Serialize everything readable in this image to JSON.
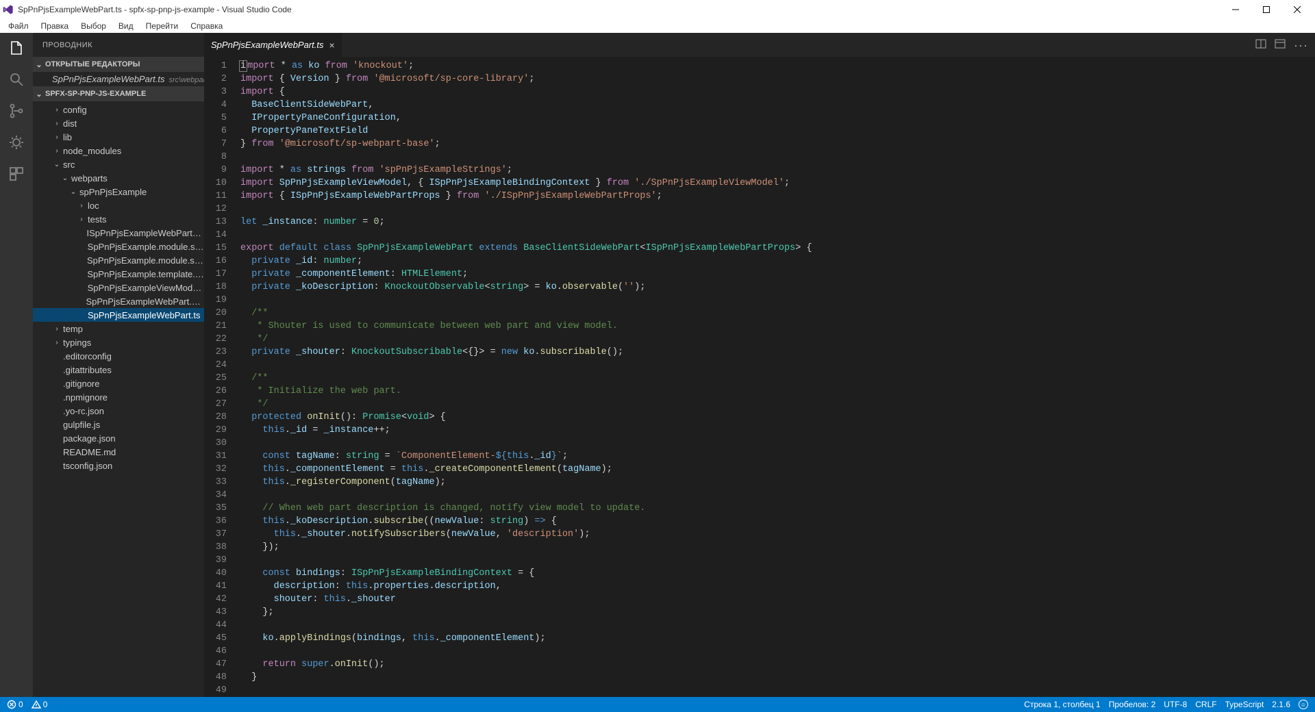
{
  "window_title": "SpPnPjsExampleWebPart.ts - spfx-sp-pnp-js-example - Visual Studio Code",
  "menus": [
    "Файл",
    "Правка",
    "Выбор",
    "Вид",
    "Перейти",
    "Справка"
  ],
  "sidebar_title": "ПРОВОДНИК",
  "open_editors_hdr": "ОТКРЫТЫЕ РЕДАКТОРЫ",
  "open_editor_name": "SpPnPjsExampleWebPart.ts",
  "open_editor_path": "src\\webparts\\spPnPjsEx…",
  "workspace_name": "SPFX-SP-PNP-JS-EXAMPLE",
  "tree": [
    {
      "d": 1,
      "chev": "›",
      "name": "config"
    },
    {
      "d": 1,
      "chev": "›",
      "name": "dist"
    },
    {
      "d": 1,
      "chev": "›",
      "name": "lib"
    },
    {
      "d": 1,
      "chev": "›",
      "name": "node_modules"
    },
    {
      "d": 1,
      "chev": "⌄",
      "name": "src"
    },
    {
      "d": 2,
      "chev": "⌄",
      "name": "webparts"
    },
    {
      "d": 3,
      "chev": "⌄",
      "name": "spPnPjsExample"
    },
    {
      "d": 4,
      "chev": "›",
      "name": "loc"
    },
    {
      "d": 4,
      "chev": "›",
      "name": "tests"
    },
    {
      "d": 4,
      "chev": "",
      "name": "ISpPnPjsExampleWebPartProps.ts"
    },
    {
      "d": 4,
      "chev": "",
      "name": "SpPnPjsExample.module.scss"
    },
    {
      "d": 4,
      "chev": "",
      "name": "SpPnPjsExample.module.scss.ts"
    },
    {
      "d": 4,
      "chev": "",
      "name": "SpPnPjsExample.template.html"
    },
    {
      "d": 4,
      "chev": "",
      "name": "SpPnPjsExampleViewModel.ts"
    },
    {
      "d": 4,
      "chev": "",
      "name": "SpPnPjsExampleWebPart.manifest.json"
    },
    {
      "d": 4,
      "chev": "",
      "name": "SpPnPjsExampleWebPart.ts",
      "sel": true
    },
    {
      "d": 1,
      "chev": "›",
      "name": "temp"
    },
    {
      "d": 1,
      "chev": "›",
      "name": "typings"
    },
    {
      "d": 1,
      "chev": "",
      "name": ".editorconfig"
    },
    {
      "d": 1,
      "chev": "",
      "name": ".gitattributes"
    },
    {
      "d": 1,
      "chev": "",
      "name": ".gitignore"
    },
    {
      "d": 1,
      "chev": "",
      "name": ".npmignore"
    },
    {
      "d": 1,
      "chev": "",
      "name": ".yo-rc.json"
    },
    {
      "d": 1,
      "chev": "",
      "name": "gulpfile.js"
    },
    {
      "d": 1,
      "chev": "",
      "name": "package.json"
    },
    {
      "d": 1,
      "chev": "",
      "name": "README.md"
    },
    {
      "d": 1,
      "chev": "",
      "name": "tsconfig.json"
    }
  ],
  "tab_label": "SpPnPjsExampleWebPart.ts",
  "status": {
    "errors": "0",
    "warnings": "0",
    "cursor": "Строка 1, столбец 1",
    "spaces": "Пробелов: 2",
    "encoding": "UTF-8",
    "eol": "CRLF",
    "lang": "TypeScript",
    "ver": "2.1.6"
  },
  "code": [
    [
      [
        "i",
        "import"
      ],
      [
        "",
        " * "
      ],
      [
        "kw",
        "as"
      ],
      [
        "",
        " "
      ],
      [
        "v",
        "ko"
      ],
      [
        "",
        " "
      ],
      [
        "i",
        "from"
      ],
      [
        "",
        " "
      ],
      [
        "s",
        "'knockout'"
      ],
      [
        "",
        ";"
      ]
    ],
    [
      [
        "i",
        "import"
      ],
      [
        "",
        " { "
      ],
      [
        "v",
        "Version"
      ],
      [
        "",
        " } "
      ],
      [
        "i",
        "from"
      ],
      [
        "",
        " "
      ],
      [
        "s",
        "'@microsoft/sp-core-library'"
      ],
      [
        "",
        ";"
      ]
    ],
    [
      [
        "i",
        "import"
      ],
      [
        "",
        " {"
      ]
    ],
    [
      [
        "",
        "  "
      ],
      [
        "v",
        "BaseClientSideWebPart"
      ],
      [
        "",
        ","
      ]
    ],
    [
      [
        "",
        "  "
      ],
      [
        "v",
        "IPropertyPaneConfiguration"
      ],
      [
        "",
        ","
      ]
    ],
    [
      [
        "",
        "  "
      ],
      [
        "v",
        "PropertyPaneTextField"
      ]
    ],
    [
      [
        "",
        "} "
      ],
      [
        "i",
        "from"
      ],
      [
        "",
        " "
      ],
      [
        "s",
        "'@microsoft/sp-webpart-base'"
      ],
      [
        "",
        ";"
      ]
    ],
    [],
    [
      [
        "i",
        "import"
      ],
      [
        "",
        " * "
      ],
      [
        "kw",
        "as"
      ],
      [
        "",
        " "
      ],
      [
        "v",
        "strings"
      ],
      [
        "",
        " "
      ],
      [
        "i",
        "from"
      ],
      [
        "",
        " "
      ],
      [
        "s",
        "'spPnPjsExampleStrings'"
      ],
      [
        "",
        ";"
      ]
    ],
    [
      [
        "i",
        "import"
      ],
      [
        "",
        " "
      ],
      [
        "v",
        "SpPnPjsExampleViewModel"
      ],
      [
        "",
        ", { "
      ],
      [
        "v",
        "ISpPnPjsExampleBindingContext"
      ],
      [
        "",
        " } "
      ],
      [
        "i",
        "from"
      ],
      [
        "",
        " "
      ],
      [
        "s",
        "'./SpPnPjsExampleViewModel'"
      ],
      [
        "",
        ";"
      ]
    ],
    [
      [
        "i",
        "import"
      ],
      [
        "",
        " { "
      ],
      [
        "v",
        "ISpPnPjsExampleWebPartProps"
      ],
      [
        "",
        " } "
      ],
      [
        "i",
        "from"
      ],
      [
        "",
        " "
      ],
      [
        "s",
        "'./ISpPnPjsExampleWebPartProps'"
      ],
      [
        "",
        ";"
      ]
    ],
    [],
    [
      [
        "kw",
        "let"
      ],
      [
        "",
        " "
      ],
      [
        "v",
        "_instance"
      ],
      [
        "",
        ": "
      ],
      [
        "t",
        "number"
      ],
      [
        "",
        " = "
      ],
      [
        "n",
        "0"
      ],
      [
        "",
        ";"
      ]
    ],
    [],
    [
      [
        "i",
        "export"
      ],
      [
        "",
        " "
      ],
      [
        "kw",
        "default"
      ],
      [
        "",
        " "
      ],
      [
        "kw",
        "class"
      ],
      [
        "",
        " "
      ],
      [
        "t",
        "SpPnPjsExampleWebPart"
      ],
      [
        "",
        " "
      ],
      [
        "kw",
        "extends"
      ],
      [
        "",
        " "
      ],
      [
        "t",
        "BaseClientSideWebPart"
      ],
      [
        "",
        "<"
      ],
      [
        "t",
        "ISpPnPjsExampleWebPartProps"
      ],
      [
        "",
        "> {"
      ]
    ],
    [
      [
        "",
        "  "
      ],
      [
        "kw",
        "private"
      ],
      [
        "",
        " "
      ],
      [
        "v",
        "_id"
      ],
      [
        "",
        ": "
      ],
      [
        "t",
        "number"
      ],
      [
        "",
        ";"
      ]
    ],
    [
      [
        "",
        "  "
      ],
      [
        "kw",
        "private"
      ],
      [
        "",
        " "
      ],
      [
        "v",
        "_componentElement"
      ],
      [
        "",
        ": "
      ],
      [
        "t",
        "HTMLElement"
      ],
      [
        "",
        ";"
      ]
    ],
    [
      [
        "",
        "  "
      ],
      [
        "kw",
        "private"
      ],
      [
        "",
        " "
      ],
      [
        "v",
        "_koDescription"
      ],
      [
        "",
        ": "
      ],
      [
        "t",
        "KnockoutObservable"
      ],
      [
        "",
        "<"
      ],
      [
        "t",
        "string"
      ],
      [
        "",
        "> = "
      ],
      [
        "v",
        "ko"
      ],
      [
        "",
        "."
      ],
      [
        "f",
        "observable"
      ],
      [
        "",
        "("
      ],
      [
        "s",
        "''"
      ],
      [
        "",
        ");"
      ]
    ],
    [],
    [
      [
        "",
        "  "
      ],
      [
        "c",
        "/**"
      ]
    ],
    [
      [
        "",
        "   "
      ],
      [
        "c",
        "* Shouter is used to communicate between web part and view model."
      ]
    ],
    [
      [
        "",
        "   "
      ],
      [
        "c",
        "*/"
      ]
    ],
    [
      [
        "",
        "  "
      ],
      [
        "kw",
        "private"
      ],
      [
        "",
        " "
      ],
      [
        "v",
        "_shouter"
      ],
      [
        "",
        ": "
      ],
      [
        "t",
        "KnockoutSubscribable"
      ],
      [
        "",
        "<{}> = "
      ],
      [
        "kw",
        "new"
      ],
      [
        "",
        " "
      ],
      [
        "v",
        "ko"
      ],
      [
        "",
        "."
      ],
      [
        "f",
        "subscribable"
      ],
      [
        "",
        "();"
      ]
    ],
    [],
    [
      [
        "",
        "  "
      ],
      [
        "c",
        "/**"
      ]
    ],
    [
      [
        "",
        "   "
      ],
      [
        "c",
        "* Initialize the web part."
      ]
    ],
    [
      [
        "",
        "   "
      ],
      [
        "c",
        "*/"
      ]
    ],
    [
      [
        "",
        "  "
      ],
      [
        "kw",
        "protected"
      ],
      [
        "",
        " "
      ],
      [
        "f",
        "onInit"
      ],
      [
        "",
        "(): "
      ],
      [
        "t",
        "Promise"
      ],
      [
        "",
        "<"
      ],
      [
        "t",
        "void"
      ],
      [
        "",
        "> {"
      ]
    ],
    [
      [
        "",
        "    "
      ],
      [
        "kw",
        "this"
      ],
      [
        "",
        "."
      ],
      [
        "v",
        "_id"
      ],
      [
        "",
        " = "
      ],
      [
        "v",
        "_instance"
      ],
      [
        "",
        "++;"
      ]
    ],
    [],
    [
      [
        "",
        "    "
      ],
      [
        "kw",
        "const"
      ],
      [
        "",
        " "
      ],
      [
        "v",
        "tagName"
      ],
      [
        "",
        ": "
      ],
      [
        "t",
        "string"
      ],
      [
        "",
        " = "
      ],
      [
        "s",
        "`ComponentElement-"
      ],
      [
        "kw",
        "${"
      ],
      [
        "kw",
        "this"
      ],
      [
        "",
        "."
      ],
      [
        "v",
        "_id"
      ],
      [
        "kw",
        "}"
      ],
      [
        "s",
        "`"
      ],
      [
        "",
        ";"
      ]
    ],
    [
      [
        "",
        "    "
      ],
      [
        "kw",
        "this"
      ],
      [
        "",
        "."
      ],
      [
        "v",
        "_componentElement"
      ],
      [
        "",
        " = "
      ],
      [
        "kw",
        "this"
      ],
      [
        "",
        "."
      ],
      [
        "f",
        "_createComponentElement"
      ],
      [
        "",
        "("
      ],
      [
        "v",
        "tagName"
      ],
      [
        "",
        ");"
      ]
    ],
    [
      [
        "",
        "    "
      ],
      [
        "kw",
        "this"
      ],
      [
        "",
        "."
      ],
      [
        "f",
        "_registerComponent"
      ],
      [
        "",
        "("
      ],
      [
        "v",
        "tagName"
      ],
      [
        "",
        ");"
      ]
    ],
    [],
    [
      [
        "",
        "    "
      ],
      [
        "c",
        "// When web part description is changed, notify view model to update."
      ]
    ],
    [
      [
        "",
        "    "
      ],
      [
        "kw",
        "this"
      ],
      [
        "",
        "."
      ],
      [
        "v",
        "_koDescription"
      ],
      [
        "",
        "."
      ],
      [
        "f",
        "subscribe"
      ],
      [
        "",
        "(("
      ],
      [
        "v",
        "newValue"
      ],
      [
        "",
        ": "
      ],
      [
        "t",
        "string"
      ],
      [
        "",
        ") "
      ],
      [
        "kw",
        "=>"
      ],
      [
        "",
        " {"
      ]
    ],
    [
      [
        "",
        "      "
      ],
      [
        "kw",
        "this"
      ],
      [
        "",
        "."
      ],
      [
        "v",
        "_shouter"
      ],
      [
        "",
        "."
      ],
      [
        "f",
        "notifySubscribers"
      ],
      [
        "",
        "("
      ],
      [
        "v",
        "newValue"
      ],
      [
        "",
        ", "
      ],
      [
        "s",
        "'description'"
      ],
      [
        "",
        ");"
      ]
    ],
    [
      [
        "",
        "    });"
      ]
    ],
    [],
    [
      [
        "",
        "    "
      ],
      [
        "kw",
        "const"
      ],
      [
        "",
        " "
      ],
      [
        "v",
        "bindings"
      ],
      [
        "",
        ": "
      ],
      [
        "t",
        "ISpPnPjsExampleBindingContext"
      ],
      [
        "",
        " = {"
      ]
    ],
    [
      [
        "",
        "      "
      ],
      [
        "v",
        "description"
      ],
      [
        "",
        ": "
      ],
      [
        "kw",
        "this"
      ],
      [
        "",
        "."
      ],
      [
        "v",
        "properties"
      ],
      [
        "",
        "."
      ],
      [
        "v",
        "description"
      ],
      [
        "",
        ","
      ]
    ],
    [
      [
        "",
        "      "
      ],
      [
        "v",
        "shouter"
      ],
      [
        "",
        ": "
      ],
      [
        "kw",
        "this"
      ],
      [
        "",
        "."
      ],
      [
        "v",
        "_shouter"
      ]
    ],
    [
      [
        "",
        "    };"
      ]
    ],
    [],
    [
      [
        "",
        "    "
      ],
      [
        "v",
        "ko"
      ],
      [
        "",
        "."
      ],
      [
        "f",
        "applyBindings"
      ],
      [
        "",
        "("
      ],
      [
        "v",
        "bindings"
      ],
      [
        "",
        ", "
      ],
      [
        "kw",
        "this"
      ],
      [
        "",
        "."
      ],
      [
        "v",
        "_componentElement"
      ],
      [
        "",
        ");"
      ]
    ],
    [],
    [
      [
        "",
        "    "
      ],
      [
        "i",
        "return"
      ],
      [
        "",
        " "
      ],
      [
        "kw",
        "super"
      ],
      [
        "",
        "."
      ],
      [
        "f",
        "onInit"
      ],
      [
        "",
        "();"
      ]
    ],
    [
      [
        "",
        "  }"
      ]
    ],
    []
  ]
}
